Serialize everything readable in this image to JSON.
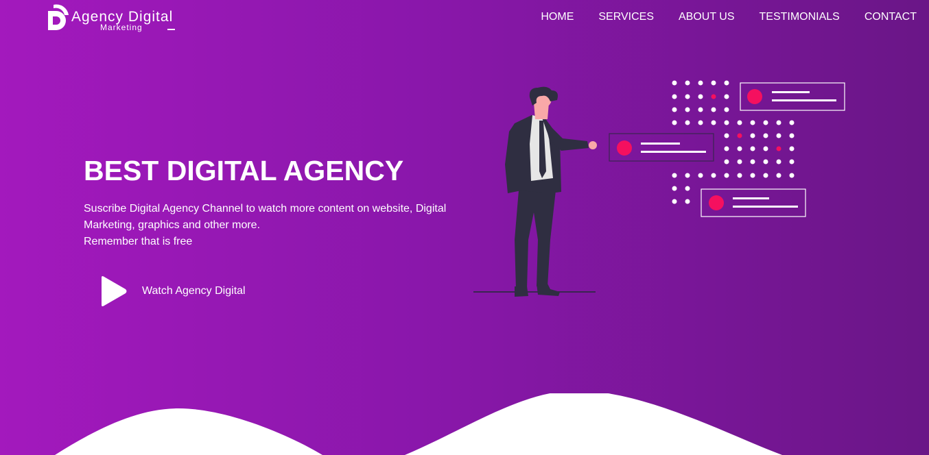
{
  "brand": {
    "title": "Agency Digital",
    "subtitle": "Marketing"
  },
  "nav": {
    "items": [
      {
        "label": "HOME"
      },
      {
        "label": "SERVICES"
      },
      {
        "label": "ABOUT US"
      },
      {
        "label": "TESTIMONIALS"
      },
      {
        "label": "CONTACT"
      }
    ]
  },
  "hero": {
    "title": "BEST DIGITAL AGENCY",
    "text_line1": "Suscribe Digital Agency Channel to watch more content on website, Digital Marketing, graphics and other more.",
    "text_line2": "Remember that is free",
    "watch_label": "Watch Agency Digital"
  },
  "colors": {
    "gradient_left": "#a319bd",
    "gradient_right": "#6a1687",
    "accent": "#f5105f",
    "suit": "#2f2e41",
    "skin": "#f9a8a8"
  },
  "icons": {
    "logo": "logo-mark-icon",
    "play": "play-icon"
  }
}
